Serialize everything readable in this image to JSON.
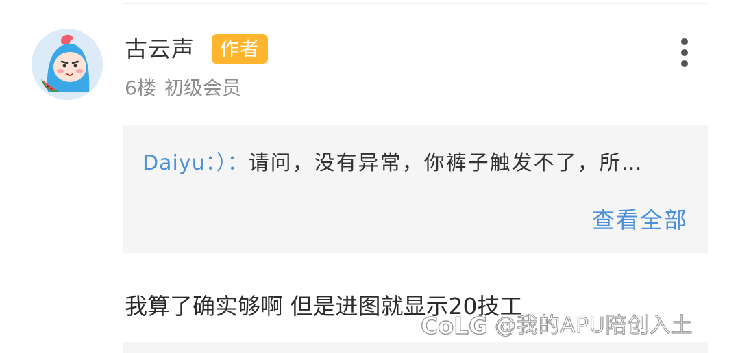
{
  "comment": {
    "user": {
      "name": "古云声",
      "badge": "作者",
      "floor": "6楼",
      "level": "初级会员"
    },
    "more_icon": "more-vertical-icon",
    "quote": {
      "author": "Daiyu：）：",
      "text": "请问，没有异常，你裤子触发不了，所…",
      "view_all_label": "查看全部"
    },
    "reply": "我算了确实够啊 但是进图就显示20技工"
  },
  "watermark": {
    "logo_text": "CoLG",
    "text": "@我的APU陪创入土"
  },
  "colors": {
    "link_blue": "#4a90d9",
    "badge_orange": "#ffb52e",
    "quote_bg": "#f5f5f5"
  }
}
